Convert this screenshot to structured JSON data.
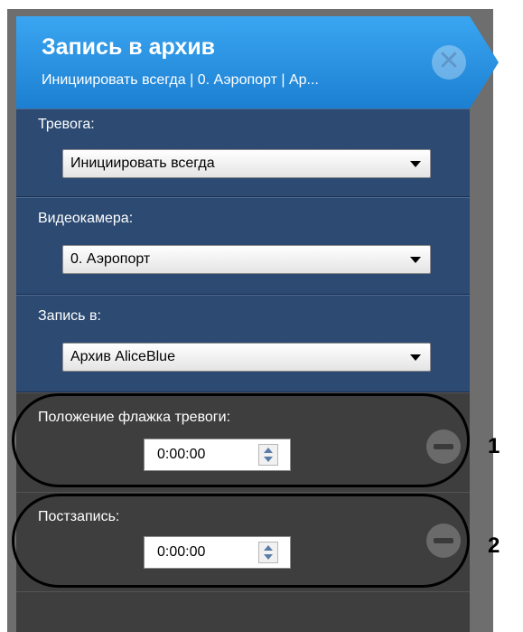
{
  "header": {
    "title": "Запись в архив",
    "subtitle": "Инициировать всегда | 0. Аэропорт | Ар..."
  },
  "icons": {
    "close": "close-icon",
    "remove": "minus-icon",
    "dropdown": "chevron-down-icon"
  },
  "sections": {
    "alarm": {
      "label": "Тревога:",
      "value": "Инициировать всегда"
    },
    "camera": {
      "label": "Видеокамера:",
      "value": "0. Аэропорт"
    },
    "record_to": {
      "label": "Запись в:",
      "value": "Архив AliceBlue"
    }
  },
  "timers": {
    "alarm_flag_position": {
      "label": "Положение флажка тревоги:",
      "value": "0:00:00"
    },
    "post_record": {
      "label": "Постзапись:",
      "value": "0:00:00"
    }
  },
  "callouts": [
    "1",
    "2"
  ],
  "colors": {
    "header_top": "#3aa6f2",
    "header_bottom": "#1c7fd1",
    "section_bg": "#2c4a72",
    "dark_bg": "#3e3e3e"
  }
}
